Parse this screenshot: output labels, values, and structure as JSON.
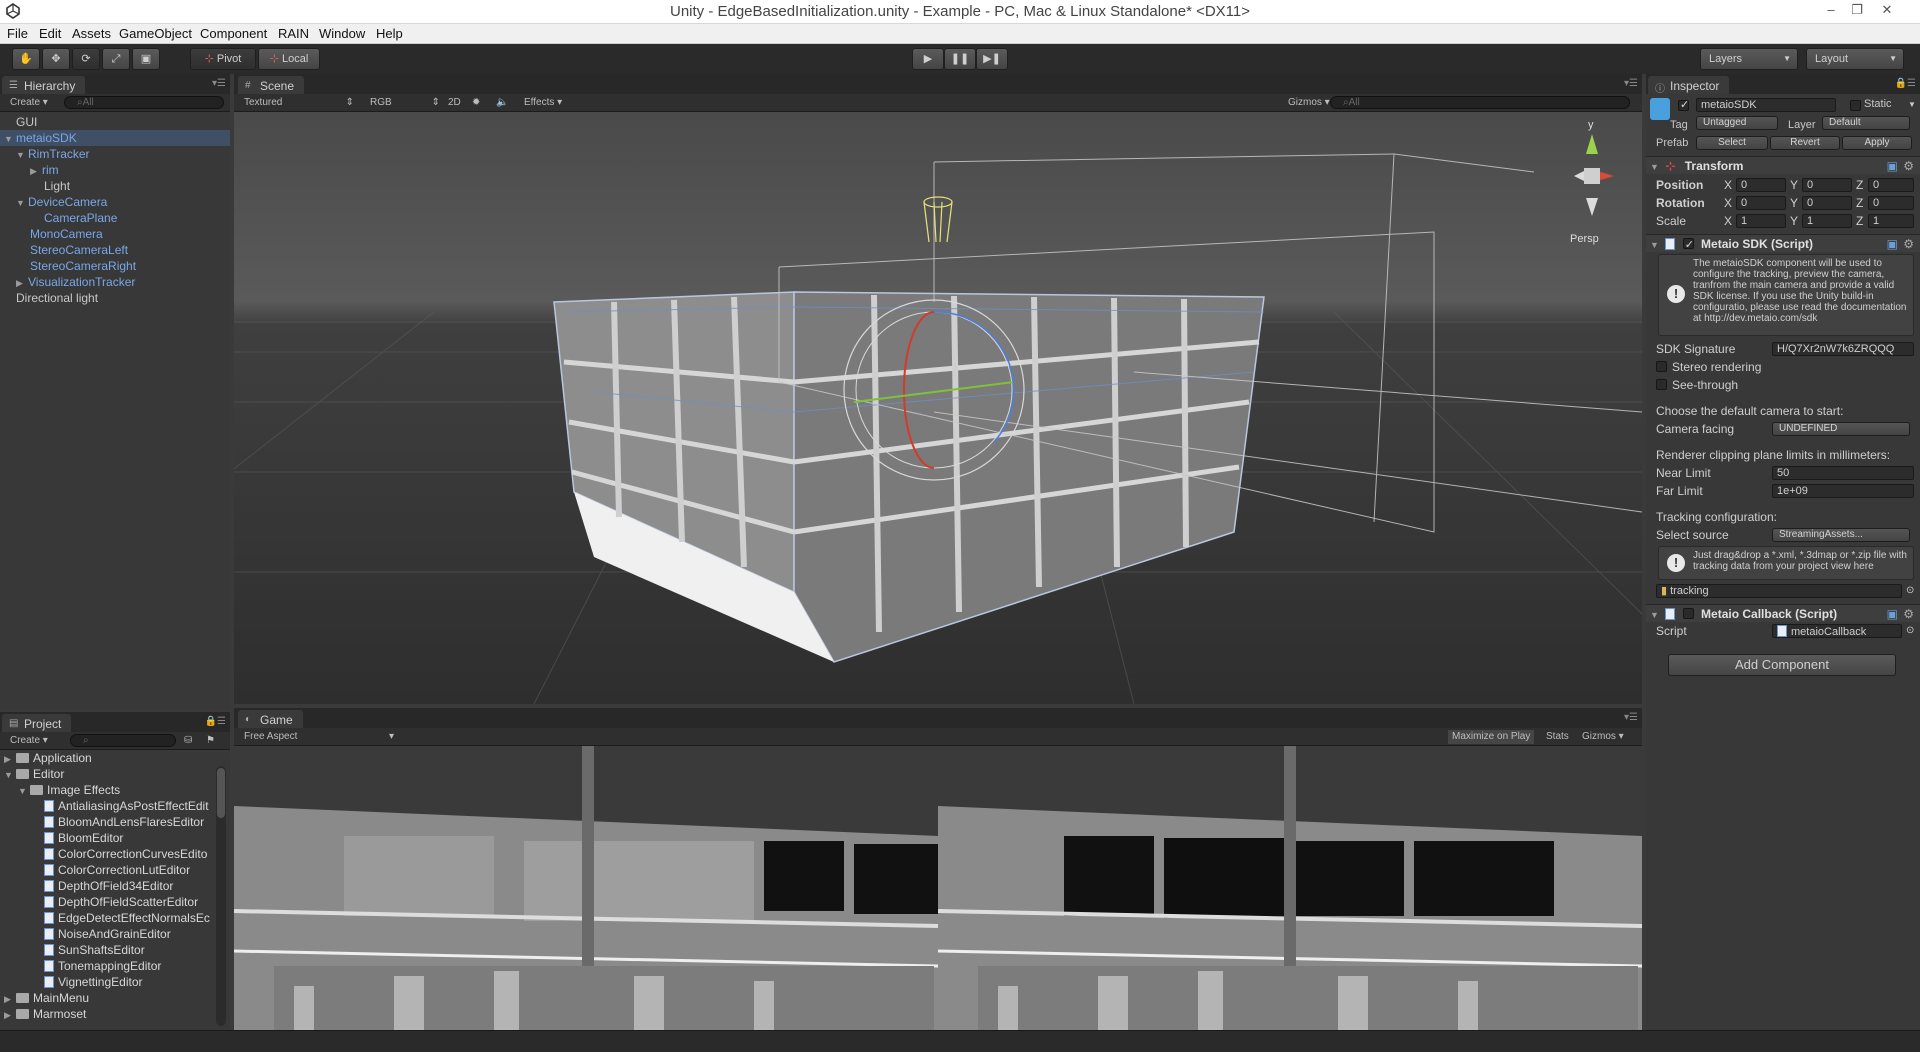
{
  "window": {
    "title": "Unity - EdgeBasedInitialization.unity - Example - PC, Mac & Linux Standalone* <DX11>",
    "controls": [
      "–",
      "❐",
      "✕"
    ]
  },
  "menu": [
    "File",
    "Edit",
    "Assets",
    "GameObject",
    "Component",
    "RAIN",
    "Window",
    "Help"
  ],
  "toolbar": {
    "pivot": "Pivot",
    "local": "Local",
    "layers": "Layers",
    "layout": "Layout"
  },
  "hierarchy": {
    "tab": "Hierarchy",
    "create": "Create",
    "search_placeholder": "All",
    "items": [
      {
        "label": "GUI"
      },
      {
        "label": "metaioSDK"
      },
      {
        "label": "RimTracker"
      },
      {
        "label": "rim"
      },
      {
        "label": "Light"
      },
      {
        "label": "DeviceCamera"
      },
      {
        "label": "CameraPlane"
      },
      {
        "label": "MonoCamera"
      },
      {
        "label": "StereoCameraLeft"
      },
      {
        "label": "StereoCameraRight"
      },
      {
        "label": "VisualizationTracker"
      },
      {
        "label": "Directional light"
      }
    ]
  },
  "scene": {
    "tab": "Scene",
    "render_mode": "Textured",
    "color_mode": "RGB",
    "mode_2d": "2D",
    "effects": "Effects",
    "gizmos": "Gizmos",
    "search_placeholder": "All",
    "persp": "Persp",
    "gizmo_y": "y"
  },
  "game": {
    "tab": "Game",
    "aspect": "Free Aspect",
    "maximize": "Maximize on Play",
    "stats": "Stats",
    "gizmos": "Gizmos"
  },
  "project": {
    "tab": "Project",
    "create": "Create",
    "items": [
      {
        "label": "Application",
        "kind": "folder"
      },
      {
        "label": "Editor",
        "kind": "folder"
      },
      {
        "label": "Image Effects",
        "kind": "folder"
      },
      {
        "label": "AntialiasingAsPostEffectEdit",
        "kind": "script"
      },
      {
        "label": "BloomAndLensFlaresEditor",
        "kind": "script"
      },
      {
        "label": "BloomEditor",
        "kind": "script"
      },
      {
        "label": "ColorCorrectionCurvesEdito",
        "kind": "script"
      },
      {
        "label": "ColorCorrectionLutEditor",
        "kind": "script"
      },
      {
        "label": "DepthOfField34Editor",
        "kind": "script"
      },
      {
        "label": "DepthOfFieldScatterEditor",
        "kind": "script"
      },
      {
        "label": "EdgeDetectEffectNormalsEc",
        "kind": "script"
      },
      {
        "label": "NoiseAndGrainEditor",
        "kind": "script"
      },
      {
        "label": "SunShaftsEditor",
        "kind": "script"
      },
      {
        "label": "TonemappingEditor",
        "kind": "script"
      },
      {
        "label": "VignettingEditor",
        "kind": "script"
      },
      {
        "label": "MainMenu",
        "kind": "folder"
      },
      {
        "label": "Marmoset",
        "kind": "folder"
      }
    ]
  },
  "inspector": {
    "tab": "Inspector",
    "object_name": "metaioSDK",
    "static": "Static",
    "tag_label": "Tag",
    "tag_value": "Untagged",
    "layer_label": "Layer",
    "layer_value": "Default",
    "prefab_label": "Prefab",
    "prefab_select": "Select",
    "prefab_revert": "Revert",
    "prefab_apply": "Apply",
    "transform": {
      "title": "Transform",
      "position_label": "Position",
      "rotation_label": "Rotation",
      "scale_label": "Scale",
      "x": "X",
      "y": "Y",
      "z": "Z",
      "position": [
        "0",
        "0",
        "0"
      ],
      "rotation": [
        "0",
        "0",
        "0"
      ],
      "scale": [
        "1",
        "1",
        "1"
      ]
    },
    "metaio": {
      "title": "Metaio SDK (Script)",
      "help": "The metaioSDK component will be used to configure the tracking, preview the camera, tranfrom the main camera and provide a valid SDK license. If you use the Unity build-in configuratio, please use read the documentation at http://dev.metaio.com/sdk",
      "signature_label": "SDK Signature",
      "signature_value": "H/Q7Xr2nW7k6ZRQQQ",
      "stereo": "Stereo rendering",
      "see_through": "See-through",
      "choose_camera": "Choose the default camera to start:",
      "camera_facing_label": "Camera facing",
      "camera_facing_value": "UNDEFINED",
      "clipping": "Renderer clipping plane limits in millimeters:",
      "near_label": "Near Limit",
      "near_value": "50",
      "far_label": "Far Limit",
      "far_value": "1e+09",
      "tracking_config": "Tracking configuration:",
      "select_source_label": "Select source",
      "select_source_value": "StreamingAssets...",
      "drag_help": "Just drag&drop a *.xml, *.3dmap or *.zip file with tracking data from your project view here",
      "tracking_asset": "tracking"
    },
    "callback": {
      "title": "Metaio Callback (Script)",
      "script_label": "Script",
      "script_value": "metaioCallback"
    },
    "add_component": "Add Component"
  }
}
